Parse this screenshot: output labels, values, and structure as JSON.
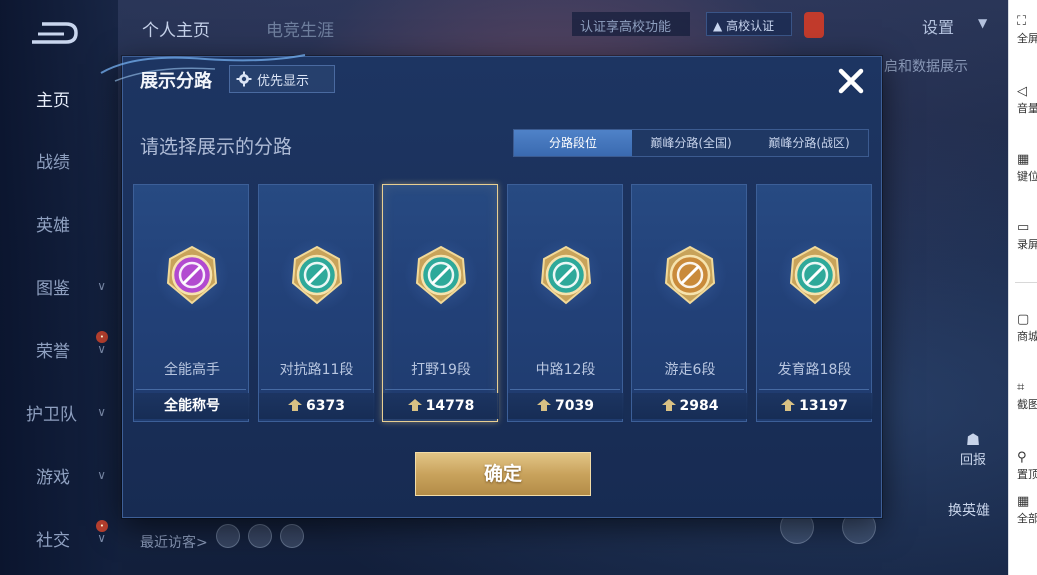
{
  "left_nav": {
    "items": [
      {
        "label": "主页",
        "active": true
      },
      {
        "label": "战绩"
      },
      {
        "label": "英雄"
      },
      {
        "label": "图鉴",
        "chevron": true
      },
      {
        "label": "荣誉",
        "chevron": true
      },
      {
        "label": "护卫队",
        "chevron": true
      },
      {
        "label": "游戏",
        "chevron": true
      },
      {
        "label": "社交",
        "chevron": true
      }
    ]
  },
  "top_bar": {
    "tabs": [
      "个人主页",
      "电竞生涯"
    ],
    "campus_label": "认证享高校功能",
    "campus_badge": "高校认证",
    "settings": "设置"
  },
  "background": {
    "hint": "启和数据展示",
    "recent_visitors": "最近访客>",
    "report": "回报",
    "swap_hero": "换英雄"
  },
  "modal": {
    "title": "展示分路",
    "priority_button": "优先显示",
    "subtitle": "请选择展示的分路",
    "segments": [
      {
        "label": "分路段位",
        "active": true
      },
      {
        "label": "巅峰分路(全国)",
        "active": false
      },
      {
        "label": "巅峰分路(战区)",
        "active": false
      }
    ],
    "cards": [
      {
        "name": "全能高手",
        "points": "全能称号",
        "show_arrow": false,
        "emblem": "all-round-emblem-icon",
        "color": "#b24ad0"
      },
      {
        "name": "对抗路11段",
        "points": "6373",
        "show_arrow": true,
        "emblem": "clash-lane-emblem-icon",
        "color": "#2ea99a"
      },
      {
        "name": "打野19段",
        "points": "14778",
        "show_arrow": true,
        "emblem": "jungle-emblem-icon",
        "color": "#2ea99a",
        "selected": true
      },
      {
        "name": "中路12段",
        "points": "7039",
        "show_arrow": true,
        "emblem": "mid-lane-emblem-icon",
        "color": "#2ea99a"
      },
      {
        "name": "游走6段",
        "points": "2984",
        "show_arrow": true,
        "emblem": "roam-emblem-icon",
        "color": "#c98a3a"
      },
      {
        "name": "发育路18段",
        "points": "13197",
        "show_arrow": true,
        "emblem": "farm-lane-emblem-icon",
        "color": "#2ea99a"
      }
    ],
    "confirm": "确定"
  },
  "sidebar": {
    "items": [
      {
        "label": "全屏",
        "icon": "fullscreen-icon",
        "glyph": "⛶"
      },
      {
        "label": "音量",
        "icon": "volume-icon",
        "glyph": "◁"
      },
      {
        "label": "键位",
        "icon": "keyboard-icon",
        "glyph": "▦"
      },
      {
        "label": "录屏",
        "icon": "record-icon",
        "glyph": "▭"
      },
      {
        "label": "商城",
        "icon": "store-icon",
        "glyph": "▢"
      },
      {
        "label": "截图",
        "icon": "screenshot-icon",
        "glyph": "⌗"
      },
      {
        "label": "置顶",
        "icon": "pin-icon",
        "glyph": "⚲"
      },
      {
        "label": "全部",
        "icon": "all-apps-icon",
        "glyph": "▦"
      }
    ]
  }
}
